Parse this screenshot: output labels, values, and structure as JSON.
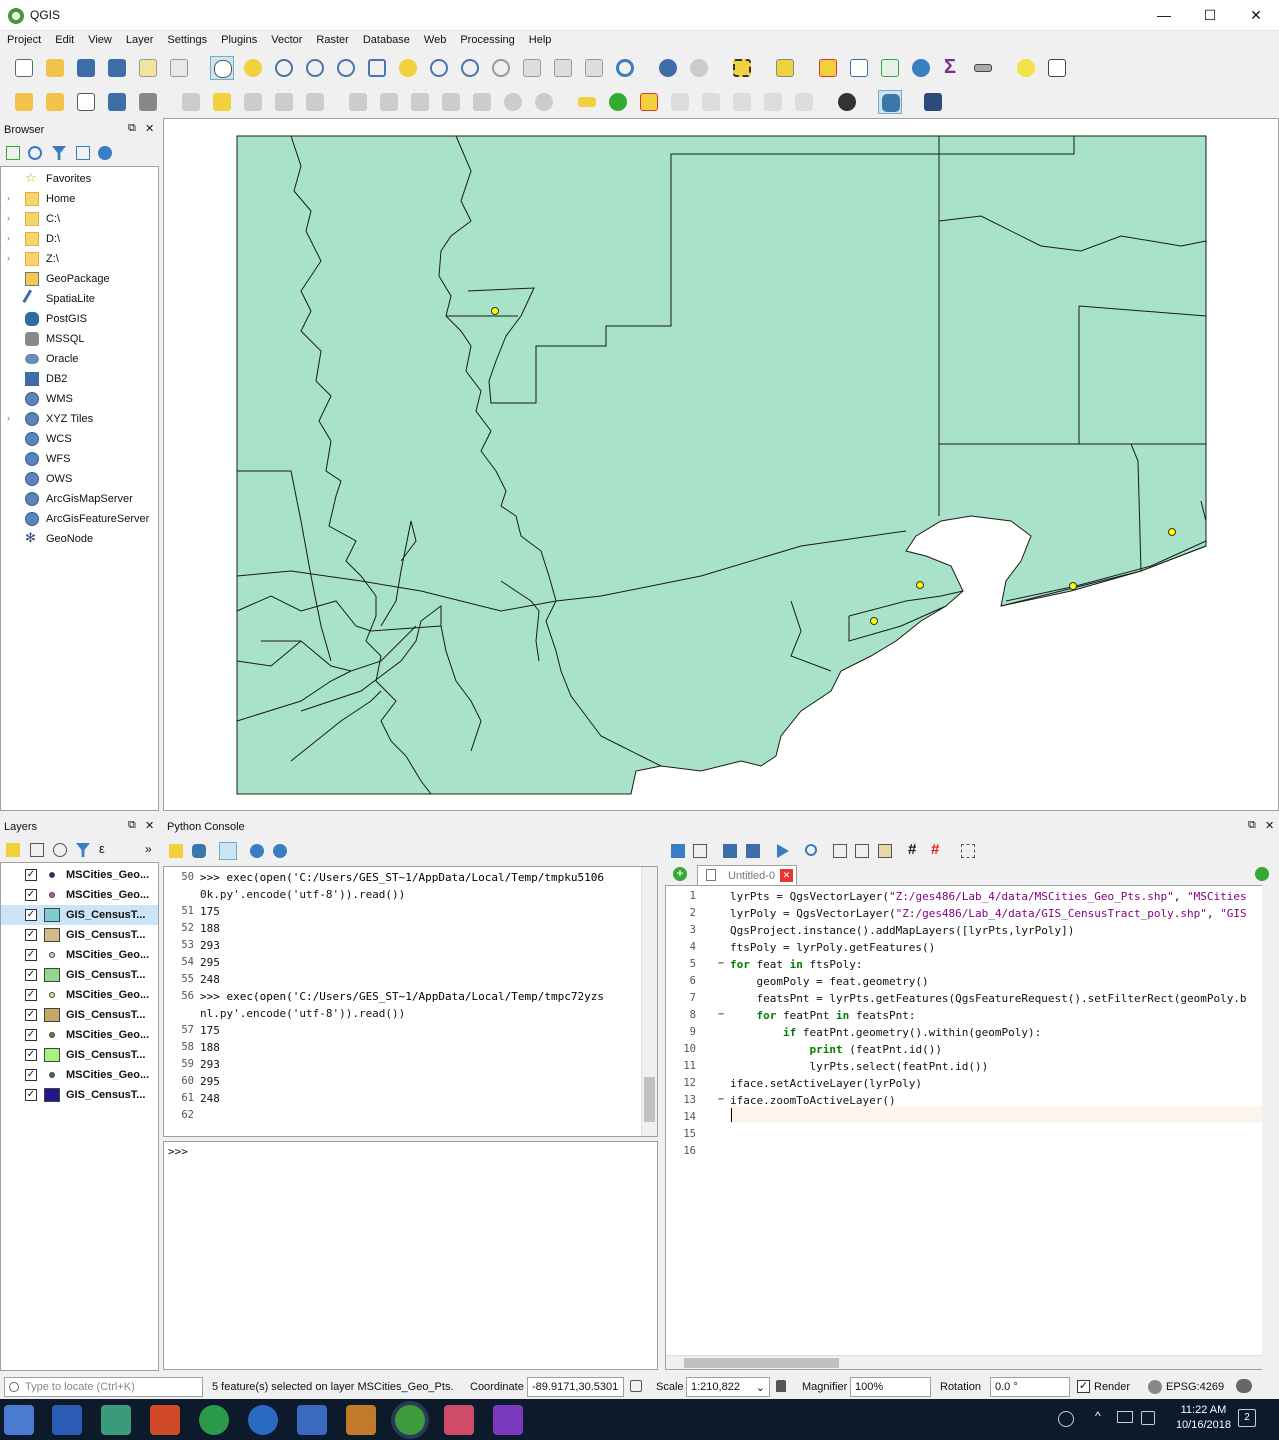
{
  "app": {
    "title": "QGIS"
  },
  "window_controls": {
    "minimize": "—",
    "maximize": "☐",
    "close": "✕"
  },
  "menu": [
    "Project",
    "Edit",
    "View",
    "Layer",
    "Settings",
    "Plugins",
    "Vector",
    "Raster",
    "Database",
    "Web",
    "Processing",
    "Help"
  ],
  "browser": {
    "title": "Browser",
    "items": [
      {
        "label": "Favorites",
        "icon": "star-icon",
        "expand": false
      },
      {
        "label": "Home",
        "icon": "folder-icon",
        "expand": true
      },
      {
        "label": "C:\\",
        "icon": "folder-icon",
        "expand": true
      },
      {
        "label": "D:\\",
        "icon": "folder-icon",
        "expand": true
      },
      {
        "label": "Z:\\",
        "icon": "folder-icon",
        "expand": true
      },
      {
        "label": "GeoPackage",
        "icon": "geopackage-icon",
        "expand": false
      },
      {
        "label": "SpatiaLite",
        "icon": "spatialite-icon",
        "expand": false
      },
      {
        "label": "PostGIS",
        "icon": "postgis-icon",
        "expand": false
      },
      {
        "label": "MSSQL",
        "icon": "mssql-icon",
        "expand": false
      },
      {
        "label": "Oracle",
        "icon": "oracle-icon",
        "expand": false
      },
      {
        "label": "DB2",
        "icon": "db2-icon",
        "expand": false
      },
      {
        "label": "WMS",
        "icon": "globe-icon",
        "expand": false
      },
      {
        "label": "XYZ Tiles",
        "icon": "globe-icon",
        "expand": true
      },
      {
        "label": "WCS",
        "icon": "globe-icon",
        "expand": false
      },
      {
        "label": "WFS",
        "icon": "globe-icon",
        "expand": false
      },
      {
        "label": "OWS",
        "icon": "globe-icon",
        "expand": false
      },
      {
        "label": "ArcGisMapServer",
        "icon": "globe-icon",
        "expand": false
      },
      {
        "label": "ArcGisFeatureServer",
        "icon": "globe-icon",
        "expand": false
      },
      {
        "label": "GeoNode",
        "icon": "geonode-icon",
        "expand": false
      }
    ]
  },
  "layers": {
    "title": "Layers",
    "items": [
      {
        "label": "MSCities_Geo...",
        "type": "point",
        "color": "#2a2a7a",
        "selected": false
      },
      {
        "label": "MSCities_Geo...",
        "type": "point",
        "color": "#b05ab0",
        "selected": false
      },
      {
        "label": "GIS_CensusT...",
        "type": "poly",
        "color": "#7ecbd1",
        "selected": true
      },
      {
        "label": "GIS_CensusT...",
        "type": "poly",
        "color": "#d2bb8a",
        "selected": false
      },
      {
        "label": "MSCities_Geo...",
        "type": "point",
        "color": "#d8cfa8",
        "selected": false
      },
      {
        "label": "GIS_CensusT...",
        "type": "poly",
        "color": "#93d68e",
        "selected": false
      },
      {
        "label": "MSCities_Geo...",
        "type": "point",
        "color": "#e6d97a",
        "selected": false
      },
      {
        "label": "GIS_CensusT...",
        "type": "poly",
        "color": "#c4a865",
        "selected": false
      },
      {
        "label": "MSCities_Geo...",
        "type": "point",
        "color": "#4d8a3c",
        "selected": false
      },
      {
        "label": "GIS_CensusT...",
        "type": "poly",
        "color": "#a6f27f",
        "selected": false
      },
      {
        "label": "MSCities_Geo...",
        "type": "point",
        "color": "#3c6a7a",
        "selected": false
      },
      {
        "label": "GIS_CensusT...",
        "type": "poly",
        "color": "#24168c",
        "selected": false
      }
    ]
  },
  "console": {
    "title": "Python Console",
    "output": [
      {
        "num": "50",
        "text": ">>> exec(open('C:/Users/GES_ST~1/AppData/Local/Temp/tmpku5106",
        "cont": "0k.py'.encode('utf-8')).read())"
      },
      {
        "num": "51",
        "text": "175"
      },
      {
        "num": "52",
        "text": "188"
      },
      {
        "num": "53",
        "text": "293"
      },
      {
        "num": "54",
        "text": "295"
      },
      {
        "num": "55",
        "text": "248"
      },
      {
        "num": "56",
        "text": ">>> exec(open('C:/Users/GES_ST~1/AppData/Local/Temp/tmpc72yzs",
        "cont": "nl.py'.encode('utf-8')).read())"
      },
      {
        "num": "57",
        "text": "175"
      },
      {
        "num": "58",
        "text": "188"
      },
      {
        "num": "59",
        "text": "293"
      },
      {
        "num": "60",
        "text": "295"
      },
      {
        "num": "61",
        "text": "248"
      },
      {
        "num": "62",
        "text": ""
      }
    ],
    "prompt": ">>>"
  },
  "editor": {
    "tab": "Untitled-0",
    "lines": [
      "lyrPts = QgsVectorLayer(\"Z:/ges486/Lab_4/data/MSCities_Geo_Pts.shp\", \"MSCities",
      "lyrPoly = QgsVectorLayer(\"Z:/ges486/Lab_4/data/GIS_CensusTract_poly.shp\", \"GIS",
      "QgsProject.instance().addMapLayers([lyrPts,lyrPoly])",
      "ftsPoly = lyrPoly.getFeatures()",
      "for feat in ftsPoly:",
      "    geomPoly = feat.geometry()",
      "    featsPnt = lyrPts.getFeatures(QgsFeatureRequest().setFilterRect(geomPoly.b",
      "    for featPnt in featsPnt:",
      "        if featPnt.geometry().within(geomPoly):",
      "            print (featPnt.id())",
      "            lyrPts.select(featPnt.id())",
      "iface.setActiveLayer(lyrPoly)",
      "iface.zoomToActiveLayer()",
      "",
      "",
      ""
    ],
    "line_numbers": [
      "1",
      "2",
      "3",
      "4",
      "5",
      "6",
      "7",
      "8",
      "9",
      "10",
      "11",
      "12",
      "13",
      "14",
      "15",
      "16"
    ]
  },
  "status": {
    "locate_placeholder": "Type to locate (Ctrl+K)",
    "message": "5 feature(s) selected on layer MSCities_Geo_Pts.",
    "coordinate_label": "Coordinate",
    "coordinate_value": "-89.9171,30.5301",
    "scale_label": "Scale",
    "scale_value": "1:210,822",
    "magnifier_label": "Magnifier",
    "magnifier_value": "100%",
    "rotation_label": "Rotation",
    "rotation_value": "0.0 °",
    "render_label": "Render",
    "crs": "EPSG:4269"
  },
  "taskbar": {
    "time": "11:22 AM",
    "date": "10/16/2018",
    "notifications": "2"
  },
  "colors": {
    "poly_fill": "#a8e2c8",
    "point_fill": "#ffff00",
    "accent": "#0078d7"
  }
}
